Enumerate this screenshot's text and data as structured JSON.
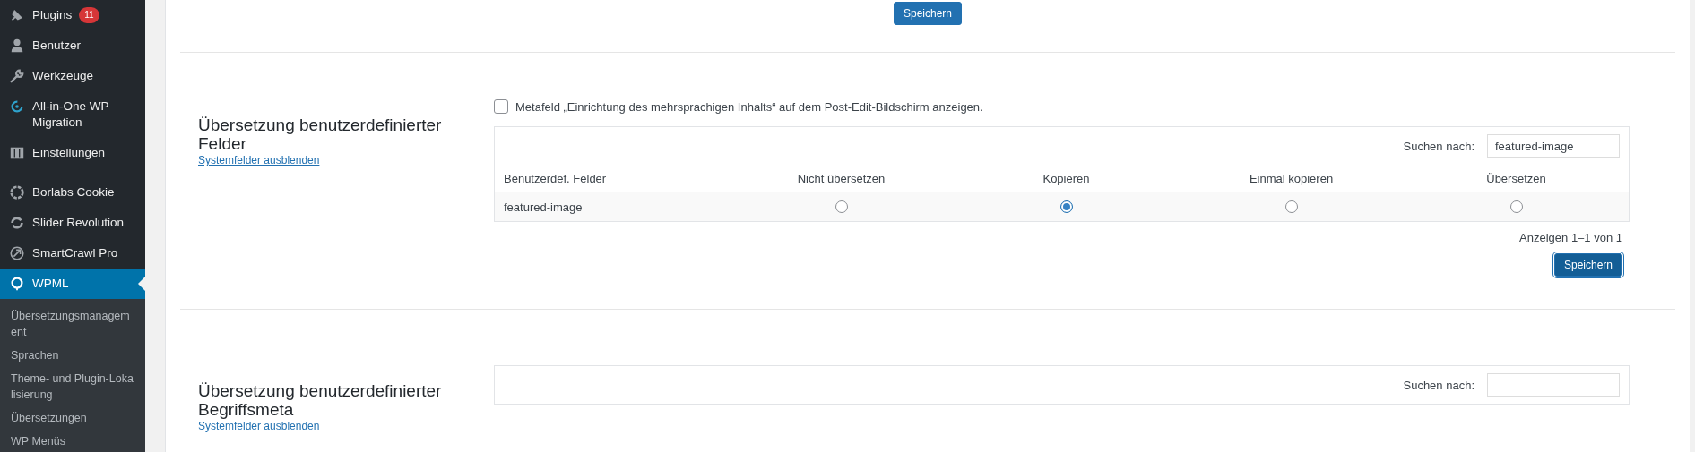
{
  "sidebar": {
    "items": [
      {
        "label": "Plugins",
        "badge": "11",
        "selected": false
      },
      {
        "label": "Benutzer",
        "selected": false
      },
      {
        "label": "Werkzeuge",
        "selected": false
      },
      {
        "label": "All-in-One WP Migration",
        "selected": false
      },
      {
        "label": "Einstellungen",
        "selected": false
      },
      {
        "label": "Borlabs Cookie",
        "selected": false
      },
      {
        "label": "Slider Revolution",
        "selected": false
      },
      {
        "label": "SmartCrawl Pro",
        "selected": false
      },
      {
        "label": "WPML",
        "selected": true
      }
    ],
    "submenu": [
      "Übersetzungsmanagement",
      "Sprachen",
      "Theme- und Plugin-Lokalisierung",
      "Übersetzungen",
      "WP Menüs"
    ]
  },
  "top_button": "Speichern",
  "sections": [
    {
      "title": "Übersetzung benutzerdefinierter Felder",
      "link": "Systemfelder ausblenden",
      "checkbox": {
        "label": "Metafeld „Einrichtung des mehrsprachigen Inhalts“ auf dem Post-Edit-Bildschirm anzeigen.",
        "checked": false
      },
      "search": {
        "label": "Suchen nach:",
        "value": "featured-image"
      },
      "columns": [
        "Benutzerdef. Felder",
        "Nicht übersetzen",
        "Kopieren",
        "Einmal kopieren",
        "Übersetzen"
      ],
      "rows": [
        {
          "name": "featured-image",
          "choices": [
            {
              "selected": false
            },
            {
              "selected": true
            },
            {
              "selected": false
            },
            {
              "selected": false
            }
          ]
        }
      ],
      "footer": "Anzeigen 1–1 von 1",
      "button": "Speichern"
    },
    {
      "title": "Übersetzung benutzerdefinierter Begriffsmeta",
      "link": "Systemfelder ausblenden",
      "search": {
        "label": "Suchen nach:"
      }
    }
  ]
}
